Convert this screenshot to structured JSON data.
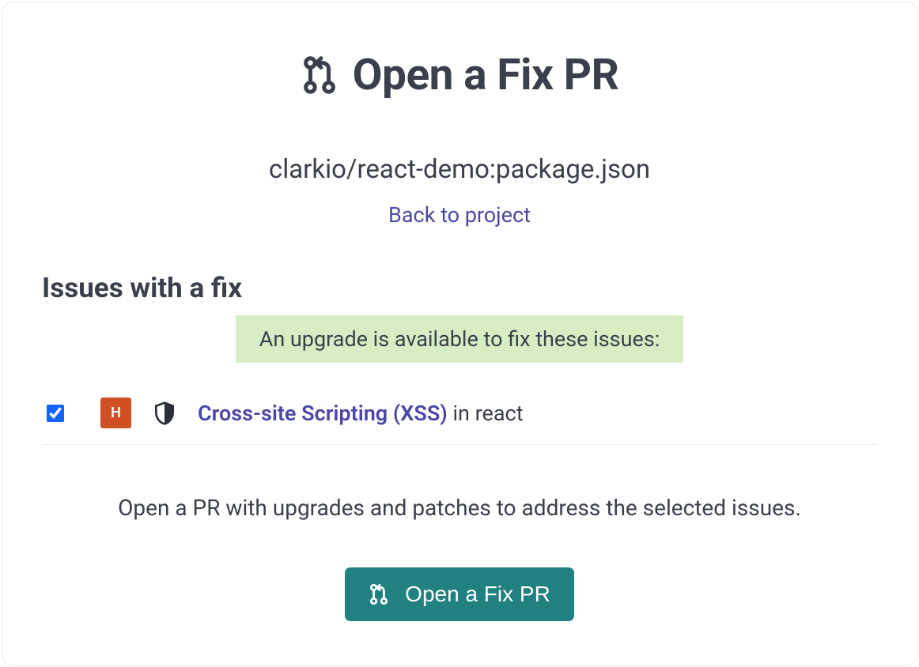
{
  "header": {
    "title": "Open a Fix PR",
    "subtitle": "clarkio/react-demo:package.json",
    "back_link": "Back to project"
  },
  "fixes": {
    "section_title": "Issues with a fix",
    "banner": "An upgrade is available to fix these issues:",
    "issues": [
      {
        "checked": true,
        "severity_letter": "H",
        "title": "Cross-site Scripting (XSS)",
        "suffix": " in react"
      }
    ]
  },
  "action": {
    "description": "Open a PR with upgrades and patches to address the selected issues.",
    "button_label": "Open a Fix PR"
  }
}
